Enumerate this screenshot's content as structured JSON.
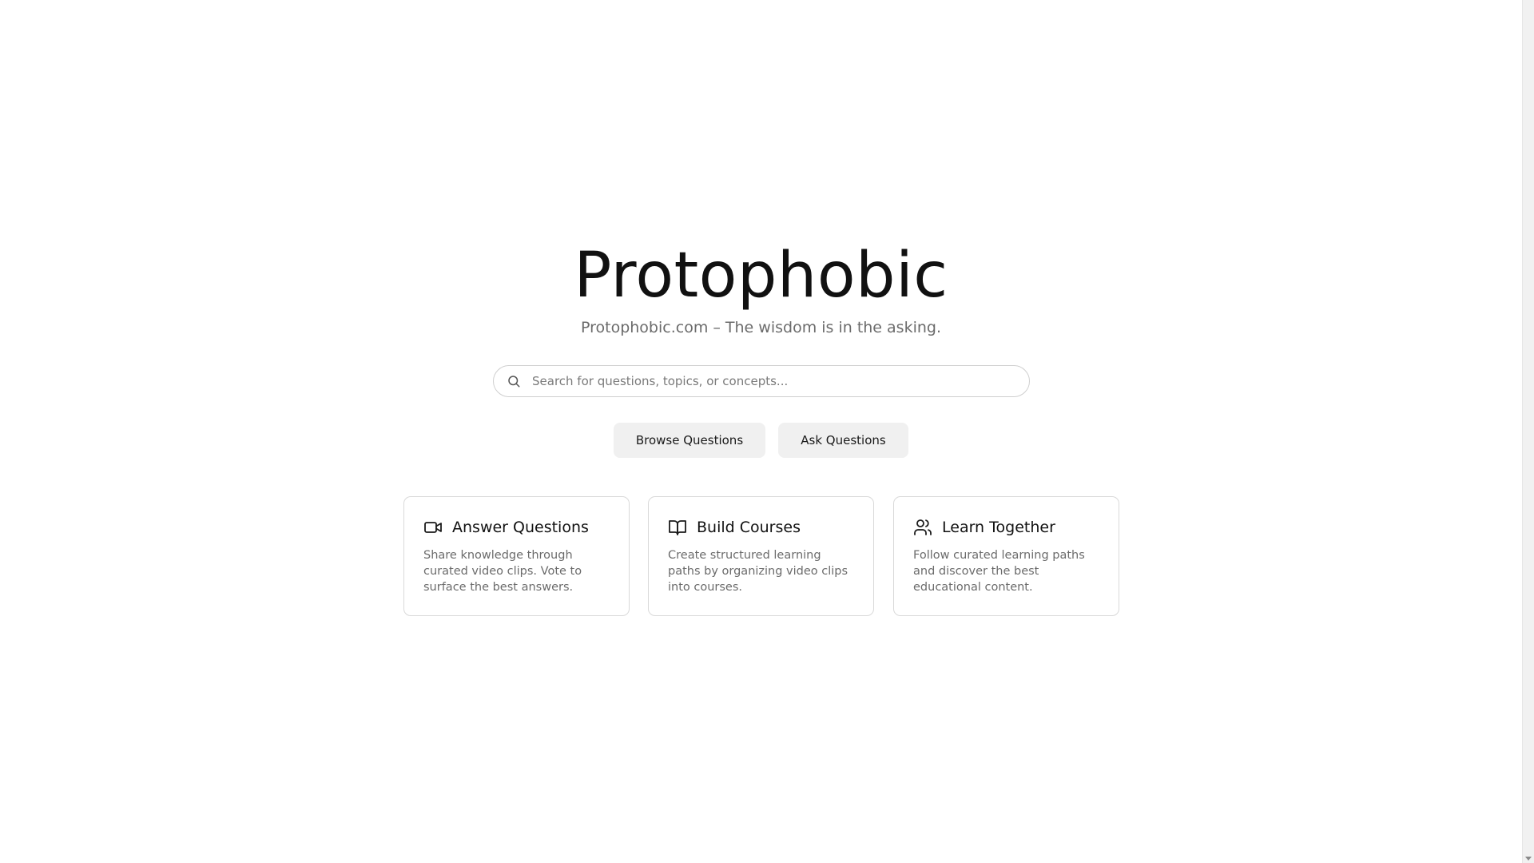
{
  "hero": {
    "title": "Protophobic",
    "tagline": "Protophobic.com – The wisdom is in the asking."
  },
  "search": {
    "placeholder": "Search for questions, topics, or concepts...",
    "value": "",
    "icon": "search-icon"
  },
  "actions": {
    "browse_label": "Browse Questions",
    "ask_label": "Ask Questions"
  },
  "features": [
    {
      "icon": "video-camera-icon",
      "title": "Answer Questions",
      "description": "Share knowledge through curated video clips. Vote to surface the best answers."
    },
    {
      "icon": "open-book-icon",
      "title": "Build Courses",
      "description": "Create structured learning paths by organizing video clips into courses."
    },
    {
      "icon": "users-icon",
      "title": "Learn Together",
      "description": "Follow curated learning paths and discover the best educational content."
    }
  ],
  "colors": {
    "text_primary": "#111111",
    "text_muted": "#6b6b6b",
    "button_bg": "#f0f0f0",
    "border": "#d9d9d9",
    "background": "#ffffff"
  }
}
